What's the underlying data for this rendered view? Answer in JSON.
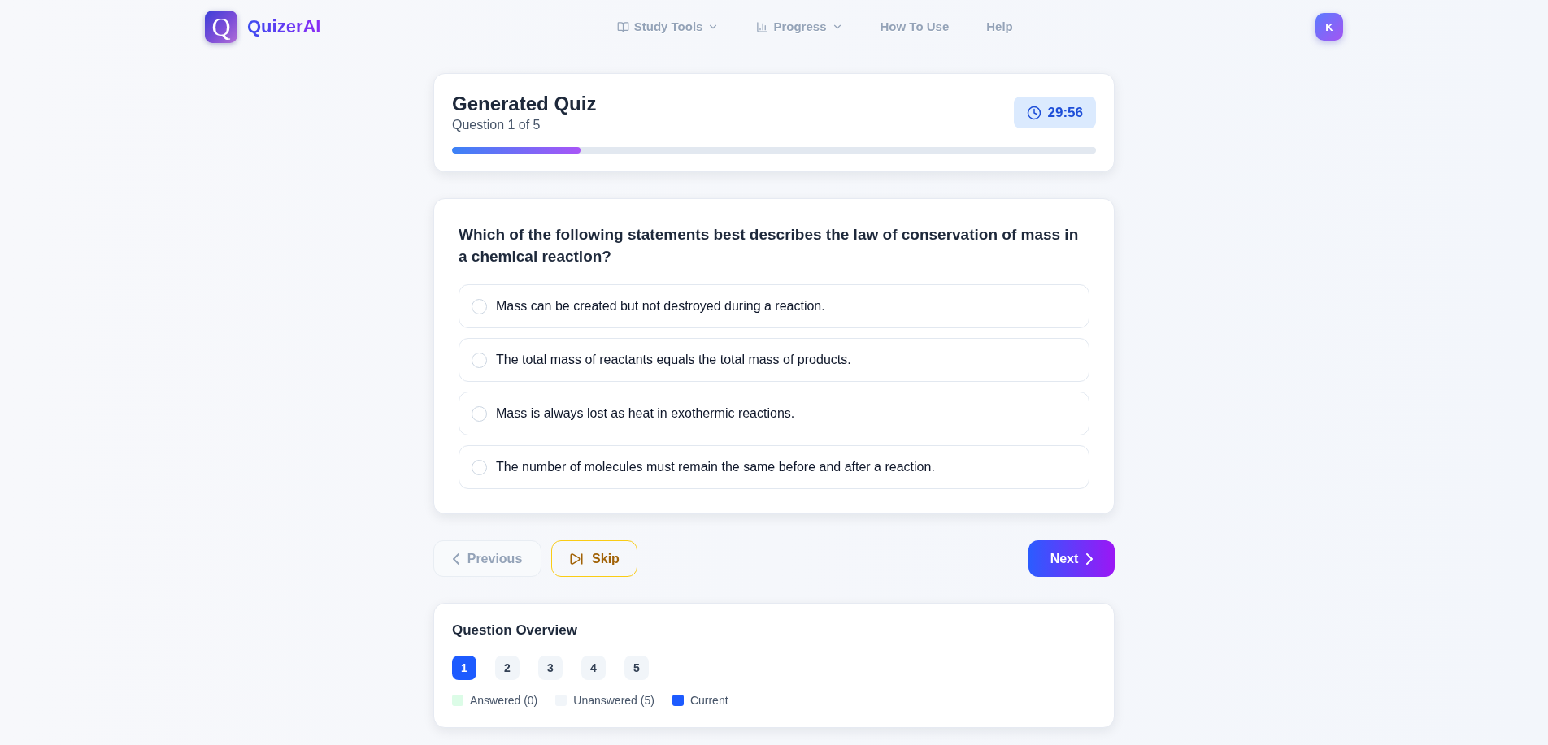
{
  "header": {
    "logo": {
      "letter": "Q"
    },
    "brand": "QuizerAI",
    "nav": [
      {
        "kind": "study",
        "label": "Study Tools"
      },
      {
        "kind": "progress",
        "label": "Progress"
      },
      {
        "kind": "link",
        "label": "How To Use"
      },
      {
        "kind": "link",
        "label": "Help"
      }
    ],
    "avatar": {
      "initial": "K"
    }
  },
  "quiz_header": {
    "title": "Generated Quiz",
    "subtitle": "Question 1 of 5",
    "timer": "29:56",
    "progress": {
      "level": 0.2
    }
  },
  "question": {
    "text": "Which of the following statements best describes the law of conservation of mass in a chemical reaction?",
    "options": [
      {
        "text": "Mass can be created but not destroyed during a reaction.",
        "selected": false
      },
      {
        "text": "The total mass of reactants equals the total mass of products.",
        "selected": false
      },
      {
        "text": "Mass is always lost as heat in exothermic reactions.",
        "selected": false
      },
      {
        "text": "The number of molecules must remain the same before and after a reaction.",
        "selected": false
      }
    ]
  },
  "buttons": [
    {
      "kind": "previous",
      "label": "Previous",
      "disabled": true
    },
    {
      "kind": "skip",
      "label": "Skip",
      "disabled": false
    },
    {
      "kind": "next",
      "label": "Next",
      "disabled": false
    }
  ],
  "overview": {
    "title": "Question Overview",
    "questions": [
      {
        "number": "1",
        "selected": true,
        "answered": false
      },
      {
        "number": "2",
        "selected": false,
        "answered": false
      },
      {
        "number": "3",
        "selected": false,
        "answered": false
      },
      {
        "number": "4",
        "selected": false,
        "answered": false
      },
      {
        "number": "5",
        "selected": false,
        "answered": false
      }
    ],
    "legend": [
      {
        "label": "Answered (0)",
        "color": "#dcfce7"
      },
      {
        "label": "Unanswered (5)",
        "color": "#f1f5f9"
      },
      {
        "label": "Current",
        "color": "#1d5bff"
      }
    ]
  }
}
